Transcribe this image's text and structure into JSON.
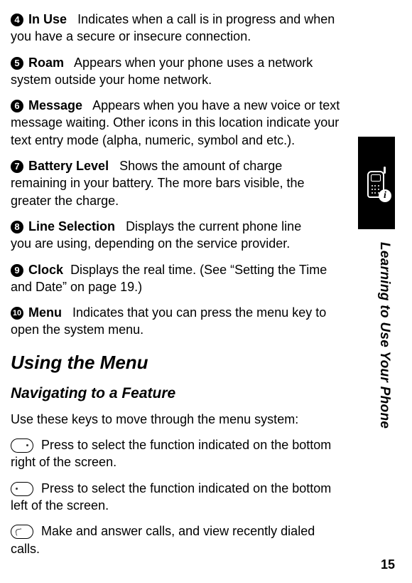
{
  "items": [
    {
      "num": "4",
      "title": "In Use",
      "desc": "Indicates when a call is in progress and when you have a secure or insecure connection."
    },
    {
      "num": "5",
      "title": "Roam",
      "desc": "Appears when your phone uses a network system outside your home network."
    },
    {
      "num": "6",
      "title": "Message",
      "desc": "Appears when you have a new voice or text message waiting. Other icons in this location indicate your text entry mode (alpha, numeric, symbol and etc.)."
    },
    {
      "num": "7",
      "title": "Battery Level",
      "desc": "Shows the amount of charge remaining in your battery. The more bars visible, the greater the charge."
    },
    {
      "num": "8",
      "title": "Line Selection",
      "desc": "Displays the current phone line you are using, depending on the service provider."
    },
    {
      "num": "9",
      "title": "Clock",
      "desc": "Displays the real time. (See “Setting the Time and Date” on page 19.)"
    },
    {
      "num": "10",
      "title": "Menu",
      "desc": "Indicates that you can press the menu key to open the system menu."
    }
  ],
  "heading2": "Using the Menu",
  "heading3": "Navigating to a Feature",
  "intro": "Use these keys to move through the menu system:",
  "keys": [
    {
      "desc": "Press to select the function indicated on the bottom right of the screen."
    },
    {
      "desc": "Press to select the function indicated on the bottom left of the screen."
    },
    {
      "desc": "Make and answer calls, and view recently dialed calls."
    }
  ],
  "sidebarText": "Learning to Use Your Phone",
  "pageNum": "15",
  "infoBadge": "i"
}
